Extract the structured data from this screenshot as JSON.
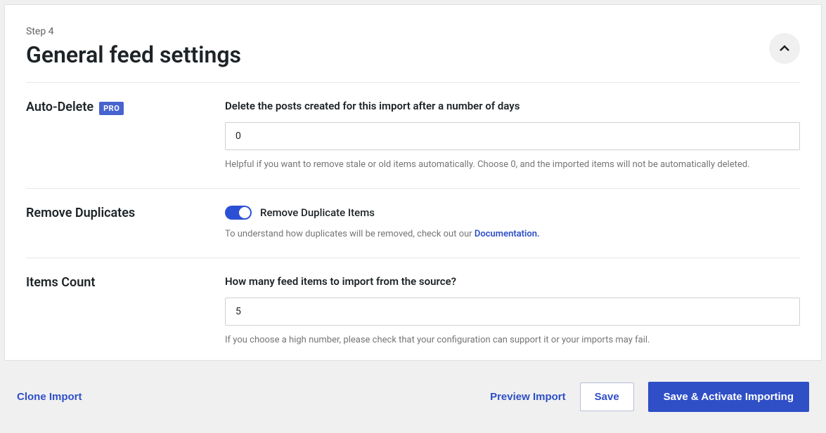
{
  "header": {
    "step": "Step 4",
    "title": "General feed settings"
  },
  "fields": {
    "autoDelete": {
      "label": "Auto-Delete",
      "badge": "PRO",
      "title": "Delete the posts created for this import after a number of days",
      "value": "0",
      "help": "Helpful if you want to remove stale or old items automatically. Choose 0, and the imported items will not be automatically deleted."
    },
    "removeDuplicates": {
      "label": "Remove Duplicates",
      "toggleLabel": "Remove Duplicate Items",
      "helpPrefix": "To understand how duplicates will be removed, check out our ",
      "helpLink": "Documentation."
    },
    "itemsCount": {
      "label": "Items Count",
      "title": "How many feed items to import from the source?",
      "value": "5",
      "help": "If you choose a high number, please check that your configuration can support it or your imports may fail."
    }
  },
  "footer": {
    "clone": "Clone Import",
    "preview": "Preview Import",
    "save": "Save",
    "saveActivate": "Save & Activate Importing"
  }
}
